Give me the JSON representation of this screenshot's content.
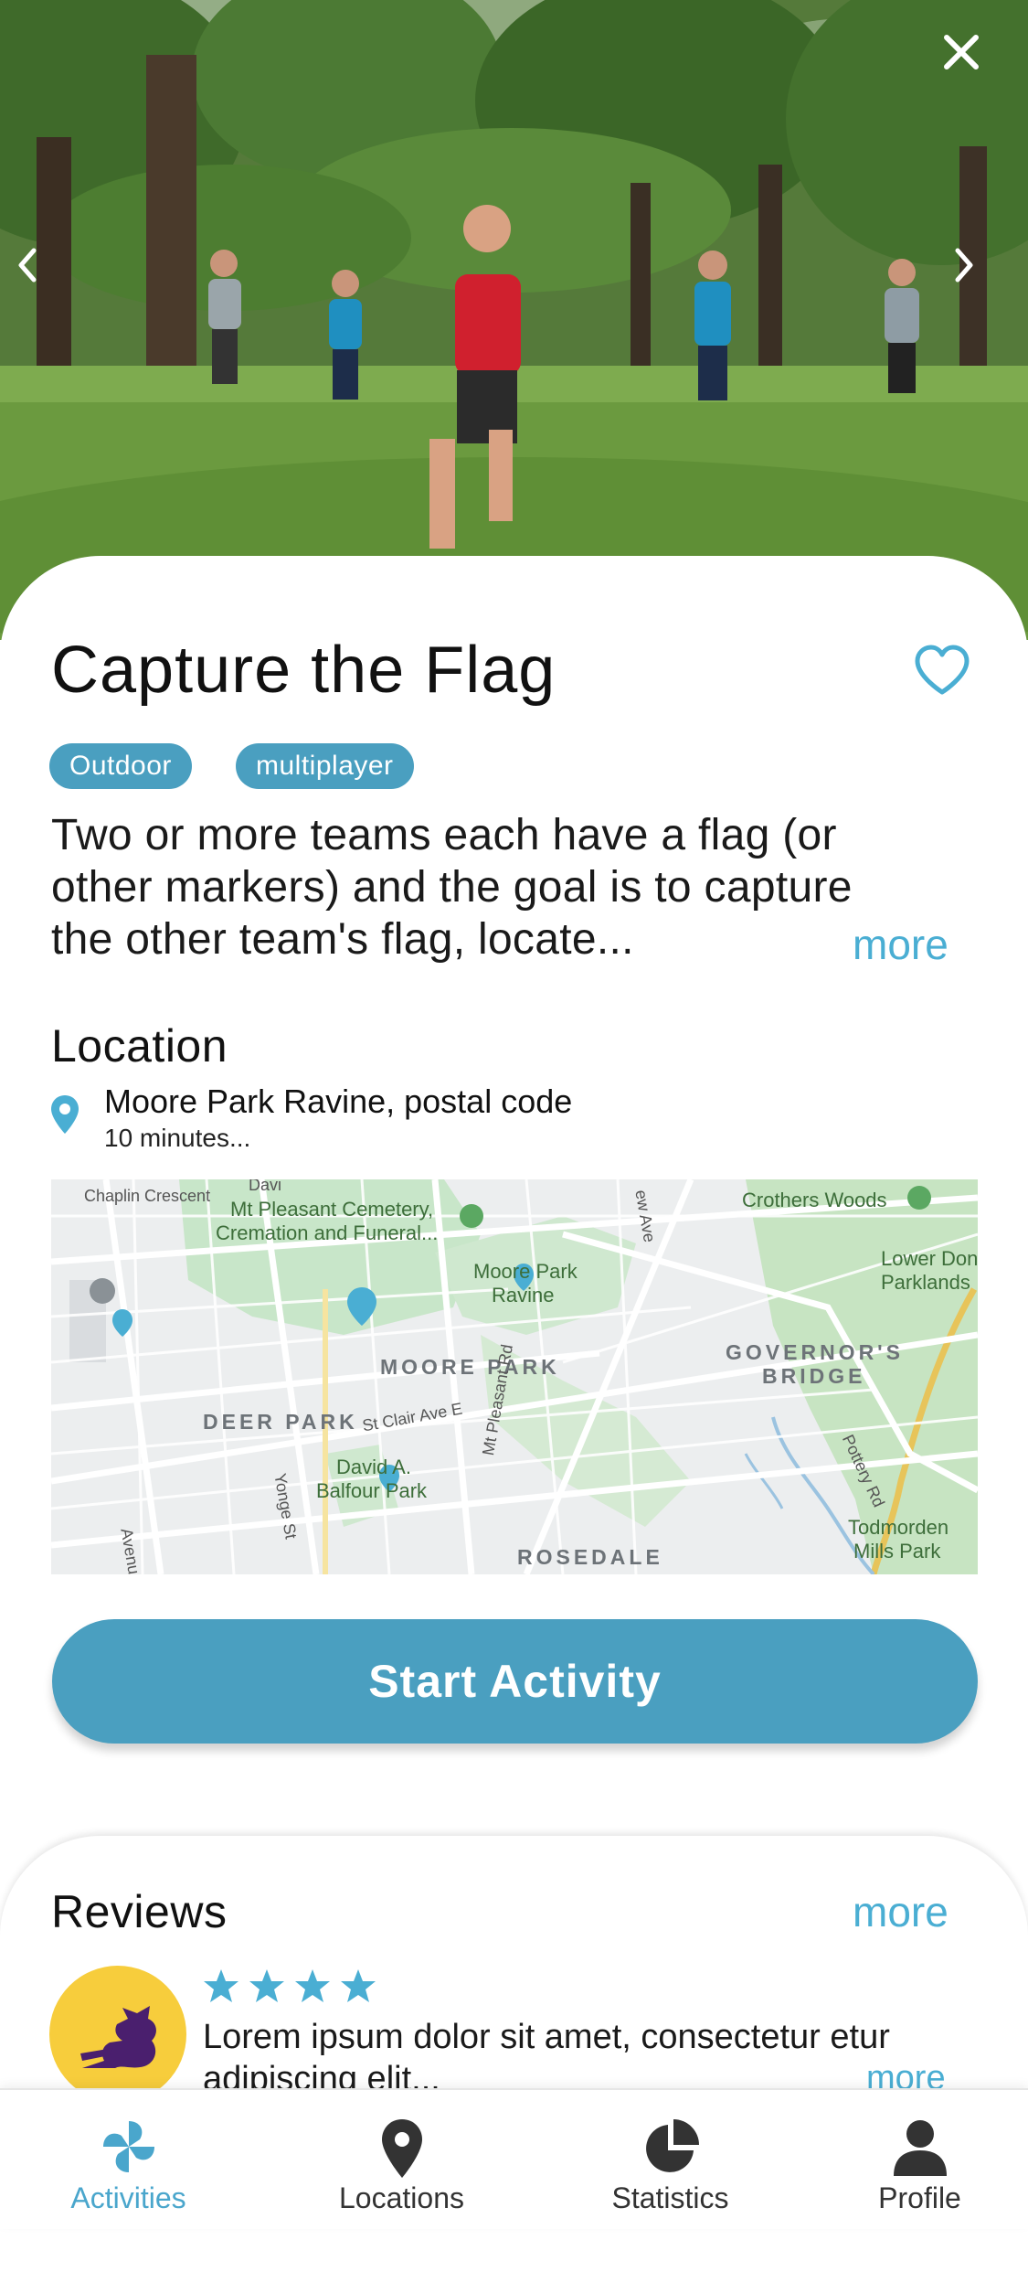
{
  "hero": {
    "close_icon": "close-icon",
    "prev_icon": "chevron-left-icon",
    "next_icon": "chevron-right-icon"
  },
  "activity": {
    "title": "Capture the Flag",
    "tags": [
      "Outdoor",
      "multiplayer"
    ],
    "description_lines": [
      "Two or more teams each have a flag (or",
      "other markers) and the goal is to capture",
      "the other team's flag, locate..."
    ],
    "more_label": "more"
  },
  "location": {
    "heading": "Location",
    "name": "Moore Park Ravine, postal code",
    "subtitle": "10 minutes...",
    "map": {
      "labels": {
        "chaplin": "Chaplin Crescent",
        "cemetery1": "Mt Pleasant Cemetery,",
        "cemetery2": "Cremation and Funeral...",
        "crothers": "Crothers Woods",
        "lower_don1": "Lower Don",
        "lower_don2": "Parklands",
        "moore_ravine1": "Moore Park",
        "moore_ravine2": "Ravine",
        "moore_park": "MOORE PARK",
        "governors1": "GOVERNOR'S",
        "governors2": "BRIDGE",
        "st_clair": "St Clair Ave E",
        "deer_park": "DEER PARK",
        "mt_pleasant_rd": "Mt Pleasant Rd",
        "david1": "David A.",
        "david2": "Balfour Park",
        "yonge": "Yonge St",
        "pottery": "Pottery Rd",
        "todmorden1": "Todmorden",
        "todmorden2": "Mills Park",
        "rosedale": "ROSEDALE",
        "avenue": "Avenue",
        "davis": "Davi",
        "bayview": "ew Ave"
      }
    }
  },
  "start_button": "Start Activity",
  "reviews": {
    "heading": "Reviews",
    "more_label": "more",
    "items": [
      {
        "rating": 4,
        "text_line1": "Lorem ipsum dolor sit amet, consectetur etur",
        "text_line2": "adipiscing elit...",
        "more_label": "more"
      }
    ]
  },
  "tabbar": {
    "tabs": [
      {
        "label": "Activities",
        "icon": "pinwheel-icon",
        "active": true
      },
      {
        "label": "Locations",
        "icon": "map-pin-icon",
        "active": false
      },
      {
        "label": "Statistics",
        "icon": "pie-chart-icon",
        "active": false
      },
      {
        "label": "Profile",
        "icon": "person-icon",
        "active": false
      }
    ]
  },
  "colors": {
    "accent": "#4a9fc0",
    "link": "#4aaed3",
    "avatar_bg": "#f7cd3c",
    "avatar_logo": "#4a1f6e"
  }
}
